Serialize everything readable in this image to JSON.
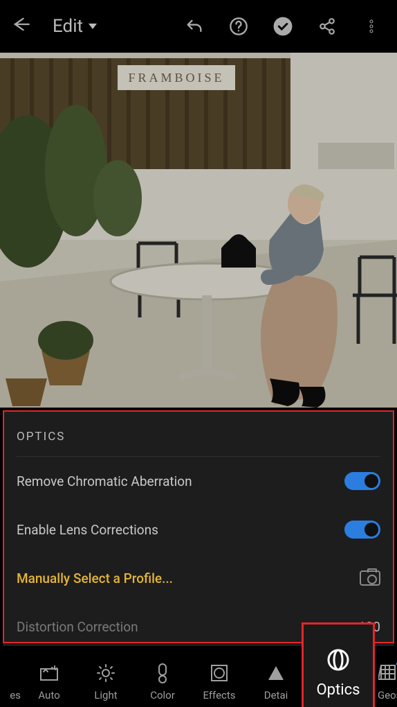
{
  "topbar": {
    "edit_label": "Edit"
  },
  "optics": {
    "section_title": "OPTICS",
    "rca_label": "Remove Chromatic Aberration",
    "rca_on": true,
    "elc_label": "Enable Lens Corrections",
    "elc_on": true,
    "msp_label": "Manually Select a Profile...",
    "dist_label": "Distortion Correction",
    "dist_value": "100"
  },
  "tools": {
    "crop_left": "es",
    "auto": "Auto",
    "light": "Light",
    "color": "Color",
    "effects": "Effects",
    "detail": "Detai",
    "optics": "Optics",
    "geometry": "Geometry"
  }
}
